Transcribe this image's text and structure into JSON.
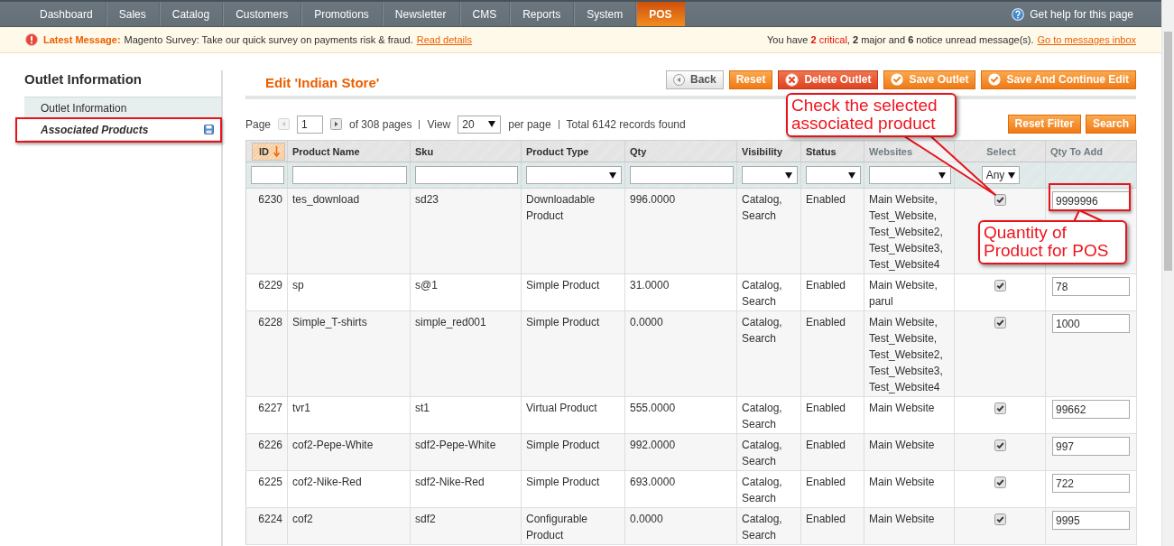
{
  "nav": {
    "items": [
      {
        "label": "Dashboard",
        "selected": false
      },
      {
        "label": "Sales",
        "selected": false
      },
      {
        "label": "Catalog",
        "selected": false
      },
      {
        "label": "Customers",
        "selected": false
      },
      {
        "label": "Promotions",
        "selected": false
      },
      {
        "label": "Newsletter",
        "selected": false
      },
      {
        "label": "CMS",
        "selected": false
      },
      {
        "label": "Reports",
        "selected": false
      },
      {
        "label": "System",
        "selected": false
      },
      {
        "label": "POS",
        "selected": true
      }
    ],
    "help": "Get help for this page"
  },
  "notice": {
    "label": "Latest Message:",
    "text": "Magento Survey: Take our quick survey on payments risk & fraud.",
    "link": "Read details",
    "summary": [
      {
        "kind": "plain",
        "text": "You have "
      },
      {
        "kind": "critical",
        "text": "**2** critical"
      },
      {
        "kind": "plain",
        "text": ", **2** major and **6** notice unread message(s)."
      }
    ],
    "summary_link": "Go to messages inbox"
  },
  "sidebar": {
    "title": "Outlet Information",
    "tabs": [
      {
        "label": "Outlet Information",
        "selected": false,
        "changed": false
      },
      {
        "label": "Associated Products",
        "selected": true,
        "changed": true
      }
    ]
  },
  "header": {
    "title": "Edit 'Indian Store'",
    "actions": [
      {
        "kind": "back",
        "label": "Back"
      },
      {
        "kind": "plain",
        "label": "Reset"
      },
      {
        "kind": "delete",
        "label": "Delete Outlet"
      },
      {
        "kind": "save",
        "label": "Save Outlet"
      },
      {
        "kind": "save",
        "label": "Save And Continue Edit"
      }
    ]
  },
  "pager": {
    "page_label": "Page",
    "prev_disabled": true,
    "page": "1",
    "next_disabled": false,
    "pages": "of 308 pages",
    "view_label": "View",
    "per_page": "20",
    "per_page_label": "per page",
    "total": "Total 6142 records found",
    "buttons": [
      "Reset Filter",
      "Search"
    ]
  },
  "grid": {
    "columns": [
      {
        "label": "ID",
        "sortable": true,
        "sorted": true
      },
      {
        "label": "Product Name",
        "sortable": true,
        "sorted": false
      },
      {
        "label": "Sku",
        "sortable": true,
        "sorted": false
      },
      {
        "label": "Product Type",
        "sortable": true,
        "sorted": false
      },
      {
        "label": "Qty",
        "sortable": true,
        "sorted": false
      },
      {
        "label": "Visibility",
        "sortable": true,
        "sorted": false
      },
      {
        "label": "Status",
        "sortable": true,
        "sorted": false
      },
      {
        "label": "Websites",
        "sortable": false,
        "sorted": false
      },
      {
        "label": "Select",
        "sortable": false,
        "sorted": false
      },
      {
        "label": "Qty To Add",
        "sortable": false,
        "sorted": false
      }
    ],
    "filters": [
      {
        "kind": "text"
      },
      {
        "kind": "text"
      },
      {
        "kind": "text"
      },
      {
        "kind": "select"
      },
      {
        "kind": "text"
      },
      {
        "kind": "select"
      },
      {
        "kind": "select"
      },
      {
        "kind": "select"
      },
      {
        "kind": "select",
        "value": "Any"
      },
      {
        "kind": "none"
      }
    ],
    "rows": [
      {
        "id": "6230",
        "name": "tes_download",
        "sku": "sd23",
        "type": "Downloadable Product",
        "qty": "996.0000",
        "visibility": "Catalog, Search",
        "status": "Enabled",
        "websites": "Main Website, Test_Website, Test_Website2, Test_Website3, Test_Website4",
        "checked": true,
        "qty_to_add": "9999996"
      },
      {
        "id": "6229",
        "name": "sp",
        "sku": "s@1",
        "type": "Simple Product",
        "qty": "31.0000",
        "visibility": "Catalog, Search",
        "status": "Enabled",
        "websites": "Main Website, parul",
        "checked": true,
        "qty_to_add": "78"
      },
      {
        "id": "6228",
        "name": "Simple_T-shirts",
        "sku": "simple_red001",
        "type": "Simple Product",
        "qty": "0.0000",
        "visibility": "Catalog, Search",
        "status": "Enabled",
        "websites": "Main Website, Test_Website, Test_Website2, Test_Website3, Test_Website4",
        "checked": true,
        "qty_to_add": "1000"
      },
      {
        "id": "6227",
        "name": "tvr1",
        "sku": "st1",
        "type": "Virtual Product",
        "qty": "555.0000",
        "visibility": "Catalog, Search",
        "status": "Enabled",
        "websites": "Main Website",
        "checked": true,
        "qty_to_add": "99662"
      },
      {
        "id": "6226",
        "name": "cof2-Pepe-White",
        "sku": "sdf2-Pepe-White",
        "type": "Simple Product",
        "qty": "992.0000",
        "visibility": "Catalog, Search",
        "status": "Enabled",
        "websites": "Main Website",
        "checked": true,
        "qty_to_add": "997"
      },
      {
        "id": "6225",
        "name": "cof2-Nike-Red",
        "sku": "sdf2-Nike-Red",
        "type": "Simple Product",
        "qty": "693.0000",
        "visibility": "Catalog, Search",
        "status": "Enabled",
        "websites": "Main Website",
        "checked": true,
        "qty_to_add": "722"
      },
      {
        "id": "6224",
        "name": "cof2",
        "sku": "sdf2",
        "type": "Configurable Product",
        "qty": "0.0000",
        "visibility": "Catalog, Search",
        "status": "Enabled",
        "websites": "Main Website",
        "checked": true,
        "qty_to_add": "9995"
      }
    ]
  },
  "annotations": [
    {
      "text": "Check the selected associated product"
    },
    {
      "text": "Quantity of Product for POS"
    }
  ]
}
